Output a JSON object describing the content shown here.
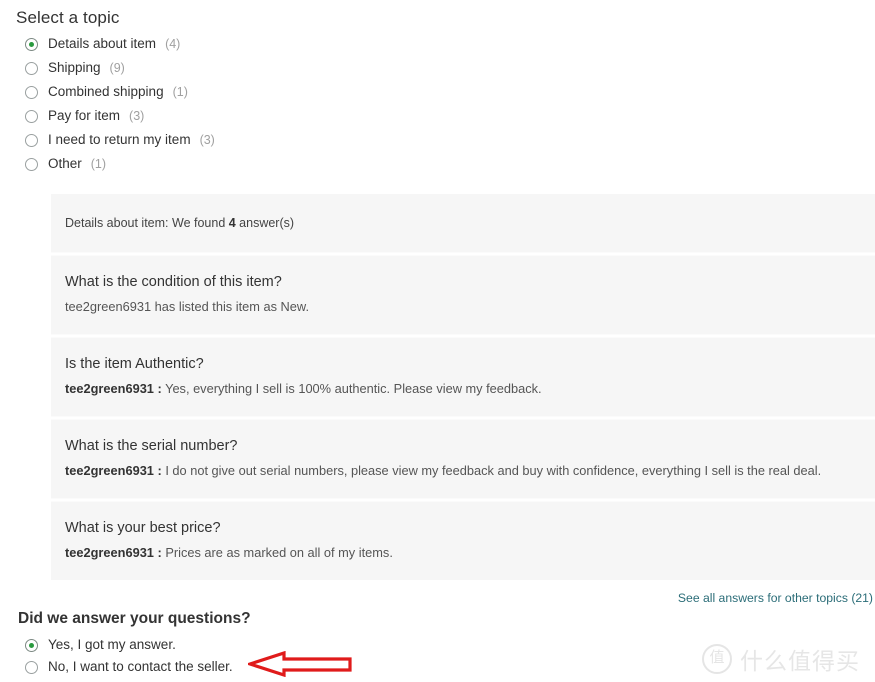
{
  "topic_selector": {
    "title": "Select a topic",
    "items": [
      {
        "label": "Details about item",
        "count": "(4)",
        "selected": true
      },
      {
        "label": "Shipping",
        "count": "(9)",
        "selected": false
      },
      {
        "label": "Combined shipping",
        "count": "(1)",
        "selected": false
      },
      {
        "label": "Pay for item",
        "count": "(3)",
        "selected": false
      },
      {
        "label": "I need to return my item",
        "count": "(3)",
        "selected": false
      },
      {
        "label": "Other",
        "count": "(1)",
        "selected": false
      }
    ]
  },
  "answers_panel": {
    "header_prefix": "Details about item: We found ",
    "header_count": "4",
    "header_suffix": " answer(s)",
    "rows": [
      {
        "question": "What is the condition of this item?",
        "seller": "",
        "answer": "tee2green6931 has listed this item as New."
      },
      {
        "question": "Is the item Authentic?",
        "seller": "tee2green6931 :",
        "answer": "Yes, everything I sell is 100% authentic. Please view my feedback."
      },
      {
        "question": "What is the serial number?",
        "seller": "tee2green6931 :",
        "answer": "I do not give out serial numbers, please view my feedback and buy with confidence, everything I sell is the real deal."
      },
      {
        "question": "What is your best price?",
        "seller": "tee2green6931 :",
        "answer": "Prices are as marked on all of my items."
      }
    ],
    "see_all_link": "See all answers for other topics (21)"
  },
  "feedback": {
    "title": "Did we answer your questions?",
    "options": [
      {
        "label": "Yes, I got my answer.",
        "selected": true
      },
      {
        "label": "No, I want to contact the seller.",
        "selected": false
      }
    ]
  },
  "annotation": {
    "arrow_color": "#e01b1b",
    "arrow_direction": "left"
  },
  "watermark": {
    "badge": "值",
    "text": "什么值得买"
  },
  "colors": {
    "panel_background": "#f6f6f6",
    "link": "#2b6d78",
    "radio_selected_dot": "#2a9a3f",
    "text": "#333333",
    "muted_text": "#a0a0a0"
  }
}
